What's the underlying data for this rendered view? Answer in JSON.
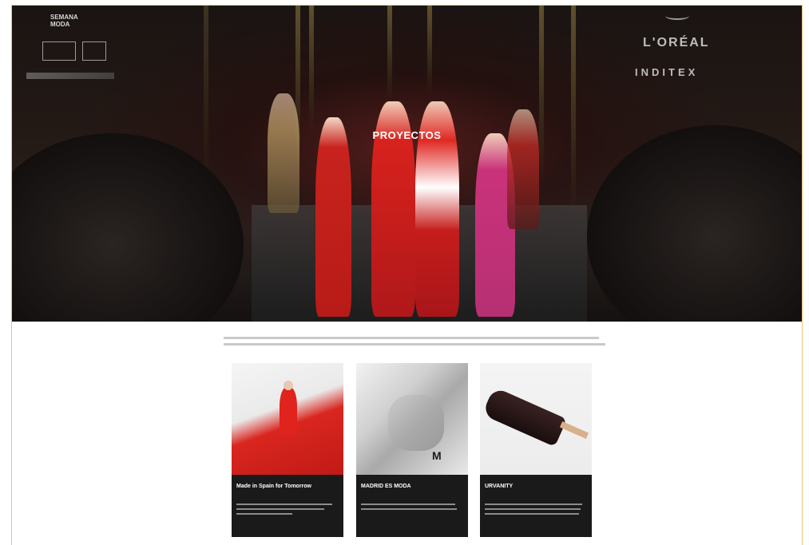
{
  "hero": {
    "title": "PROYECTOS",
    "sponsors_left": [
      "SEMANA",
      "MODA"
    ],
    "sponsors_right": [
      "L'ORÉAL",
      "INDITEX"
    ]
  },
  "intro_text": "",
  "cards": [
    {
      "title": "Made in Spain for Tomorrow",
      "description": ""
    },
    {
      "title": "MADRID ES MODA",
      "description": ""
    },
    {
      "title": "URVANITY",
      "description": ""
    }
  ],
  "colors": {
    "frame": "#f0c27a",
    "card_bg": "#1a1a1a",
    "accent_red": "#d0201c"
  }
}
